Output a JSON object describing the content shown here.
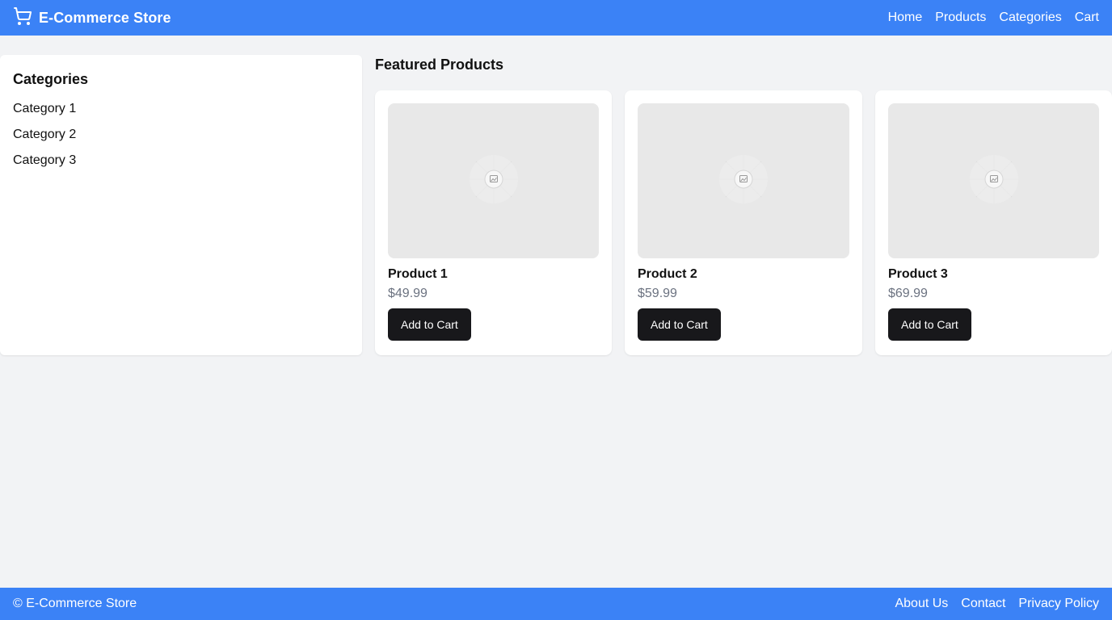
{
  "header": {
    "logo_icon": "shopping-cart-icon",
    "title": "E-Commerce Store",
    "nav": [
      "Home",
      "Products",
      "Categories",
      "Cart"
    ],
    "background": "#3b82f6"
  },
  "sidebar": {
    "heading": "Categories",
    "items": [
      "Category 1",
      "Category 2",
      "Category 3"
    ]
  },
  "main": {
    "section_title": "Featured Products",
    "products": [
      {
        "name": "Product 1",
        "price": "$49.99",
        "button": "Add to Cart",
        "image_icon": "image-placeholder-icon"
      },
      {
        "name": "Product 2",
        "price": "$59.99",
        "button": "Add to Cart",
        "image_icon": "image-placeholder-icon"
      },
      {
        "name": "Product 3",
        "price": "$69.99",
        "button": "Add to Cart",
        "image_icon": "image-placeholder-icon"
      }
    ]
  },
  "footer": {
    "copyright": "© E-Commerce Store",
    "links": [
      "About Us",
      "Contact",
      "Privacy Policy"
    ]
  }
}
